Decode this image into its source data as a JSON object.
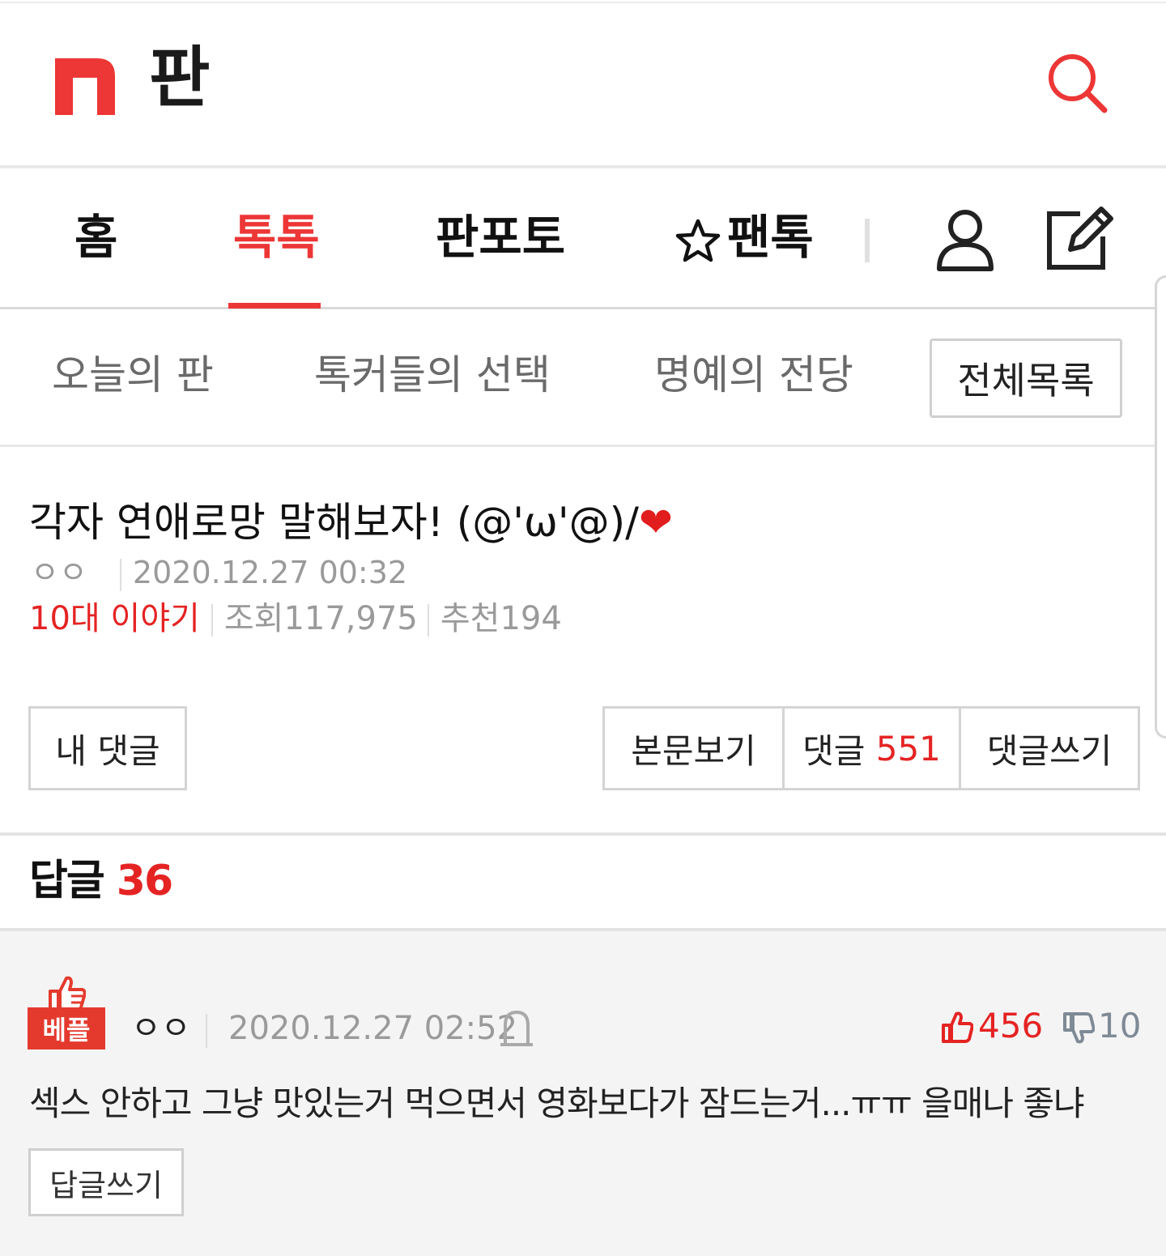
{
  "header": {
    "logo_icon": "nate-n-logo",
    "brand": "판",
    "search_icon": "search-icon",
    "accent_color": "#ed3636"
  },
  "main_nav": {
    "tabs": [
      {
        "label": "홈"
      },
      {
        "label": "톡톡",
        "active": true
      },
      {
        "label": "판포토"
      },
      {
        "label": "팬톡",
        "icon": "star-icon"
      }
    ],
    "user_icon": "user-icon",
    "write_icon": "edit-icon"
  },
  "sub_nav": {
    "items": [
      {
        "label": "오늘의 판"
      },
      {
        "label": "톡커들의 선택"
      },
      {
        "label": "명예의 전당"
      }
    ],
    "all_list": "전체목록"
  },
  "post": {
    "title": "각자 연애로망 말해보자! (@'ω'@)/",
    "title_emoji": "❤",
    "author": "ㅇㅇ",
    "date": "2020.12.27 00:32",
    "category": "10대 이야기",
    "views_label": "조회",
    "views": "117,975",
    "recommend_label": "추천",
    "recommend": "194"
  },
  "actions": {
    "my_comment": "내 댓글",
    "view_body": "본문보기",
    "comments_label": "댓글",
    "comments_count": "551",
    "write_comment": "댓글쓰기"
  },
  "replies": {
    "label": "답글",
    "count": "36",
    "items": [
      {
        "badge": "베플",
        "author": "ㅇㅇ",
        "date": "2020.12.27 02:52",
        "likes": "456",
        "dislikes": "10",
        "body": "섹스 안하고 그냥 맛있는거 먹으면서 영화보다가 잠드는거...ㅠㅠ 을매나 좋냐",
        "reply_button": "답글쓰기"
      }
    ]
  }
}
